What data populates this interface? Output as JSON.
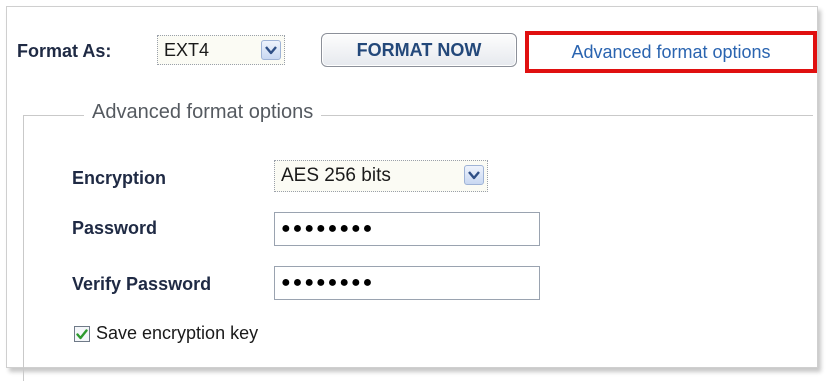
{
  "format": {
    "label": "Format As:",
    "selected": "EXT4",
    "button_label": "FORMAT NOW",
    "advanced_link": "Advanced format options"
  },
  "advanced": {
    "legend": "Advanced format options",
    "encryption_label": "Encryption",
    "encryption_selected": "AES 256 bits",
    "password_label": "Password",
    "password_value": "●●●●●●●●",
    "verify_label": "Verify Password",
    "verify_value": "●●●●●●●●",
    "save_key_label": "Save encryption key",
    "save_key_checked": true
  },
  "colors": {
    "highlight_border": "#e01010",
    "link": "#2a64b0",
    "checkmark": "#2e9a2e"
  },
  "icons": {
    "select_arrow": "chevron-down-icon",
    "check": "checkmark-icon"
  }
}
